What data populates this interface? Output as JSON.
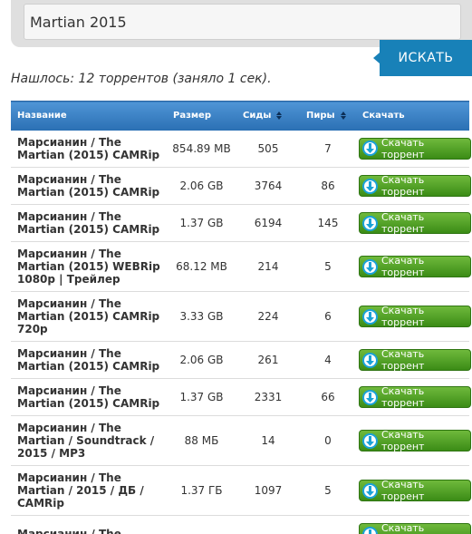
{
  "search": {
    "query": "Martian 2015",
    "button_label": "ИСКАТЬ"
  },
  "result_summary": "Нашлось: 12 торрентов (заняло 1 сек).",
  "table": {
    "headers": {
      "name": "Название",
      "size": "Размер",
      "seeds": "Сиды",
      "peers": "Пиры",
      "download": "Скачать"
    },
    "download_label": "Скачать торрент",
    "rows": [
      {
        "name": "Марсианин / The Martian (2015) CAMRip",
        "size": "854.89 MB",
        "seeds": "505",
        "peers": "7",
        "download": "Скачать торрент"
      },
      {
        "name": "Марсианин / The Martian (2015) CAMRip",
        "size": "2.06 GB",
        "seeds": "3764",
        "peers": "86",
        "download": "Скачать торрент"
      },
      {
        "name": "Марсианин / The Martian (2015) CAMRip",
        "size": "1.37 GB",
        "seeds": "6194",
        "peers": "145",
        "download": "Скачать торрент"
      },
      {
        "name": "Марсианин / The Martian (2015) WEBRip 1080p | Трейлер",
        "size": "68.12 MB",
        "seeds": "214",
        "peers": "5",
        "download": "Скачать торрент"
      },
      {
        "name": "Марсианин / The Martian (2015) CAMRip 720p",
        "size": "3.33 GB",
        "seeds": "224",
        "peers": "6",
        "download": "Скачать торрент"
      },
      {
        "name": "Марсианин / The Martian (2015) CAMRip",
        "size": "2.06 GB",
        "seeds": "261",
        "peers": "4",
        "download": "Скачать торрент"
      },
      {
        "name": "Марсианин / The Martian (2015) CAMRip",
        "size": "1.37 GB",
        "seeds": "2331",
        "peers": "66",
        "download": "Скачать торрент"
      },
      {
        "name": "Марсианин / The Martian / Soundtrack / 2015 / MP3",
        "size": "88 МБ",
        "seeds": "14",
        "peers": "0",
        "download": "Скачать торрент"
      },
      {
        "name": "Марсианин / The Martian / 2015 / ДБ / CAMRip",
        "size": "1.37 ГБ",
        "seeds": "1097",
        "peers": "5",
        "download": "Скачать торрент"
      },
      {
        "name": "Марсианин / The",
        "size": "",
        "seeds": "",
        "peers": "",
        "download": "Скачать торрент"
      }
    ]
  },
  "colors": {
    "header_blue": "#2a6fb3",
    "search_button": "#1881b8",
    "download_green": "#3b8c16"
  },
  "icons": {
    "download": "download-arrow-icon",
    "sort": "sort-arrows-icon"
  }
}
